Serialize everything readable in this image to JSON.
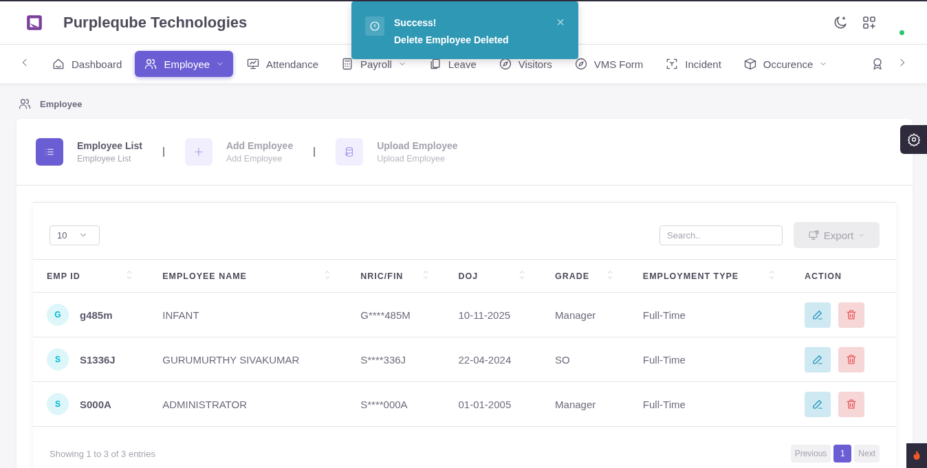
{
  "header": {
    "title": "Purpleqube Technologies"
  },
  "nav": [
    {
      "label": "Dashboard",
      "selected": false,
      "caret": false
    },
    {
      "label": "Employee",
      "selected": true,
      "caret": true
    },
    {
      "label": "Attendance",
      "selected": false,
      "caret": false
    },
    {
      "label": "Payroll",
      "selected": false,
      "caret": true
    },
    {
      "label": "Leave",
      "selected": false,
      "caret": false
    },
    {
      "label": "Visitors",
      "selected": false,
      "caret": false
    },
    {
      "label": "VMS Form",
      "selected": false,
      "caret": false
    },
    {
      "label": "Incident",
      "selected": false,
      "caret": false
    },
    {
      "label": "Occurence",
      "selected": false,
      "caret": true
    }
  ],
  "toast": {
    "title": "Success!",
    "message": "Delete Employee Deleted",
    "close": "×"
  },
  "breadcrumb": "Employee",
  "steps": [
    {
      "title": "Employee List",
      "subtitle": "Employee List",
      "selected": true
    },
    {
      "title": "Add Employee",
      "subtitle": "Add Employee",
      "selected": false
    },
    {
      "title": "Upload Employee",
      "subtitle": "Upload Employee",
      "selected": false
    }
  ],
  "table": {
    "page_size": "10",
    "search_placeholder": "Search..",
    "export": "Export",
    "columns": [
      "EMP ID",
      "EMPLOYEE NAME",
      "NRIC/FIN",
      "DOJ",
      "GRADE",
      "EMPLOYMENT TYPE",
      "ACTION"
    ],
    "rows": [
      {
        "avatar": "G",
        "emp_id": "g485m",
        "name": "INFANT",
        "nric": "G****485M",
        "doj": "10-11-2025",
        "grade": "Manager",
        "type": "Full-Time"
      },
      {
        "avatar": "S",
        "emp_id": "S1336J",
        "name": "GURUMURTHY SIVAKUMAR",
        "nric": "S****336J",
        "doj": "22-04-2024",
        "grade": "SO",
        "type": "Full-Time"
      },
      {
        "avatar": "S",
        "emp_id": "S000A",
        "name": "ADMINISTRATOR",
        "nric": "S****000A",
        "doj": "01-01-2005",
        "grade": "Manager",
        "type": "Full-Time"
      }
    ],
    "info": "Showing 1 to 3 of 3 entries",
    "pages": [
      {
        "label": "Previous",
        "selected": false
      },
      {
        "label": "1",
        "selected": true
      },
      {
        "label": "Next",
        "selected": false
      }
    ]
  }
}
